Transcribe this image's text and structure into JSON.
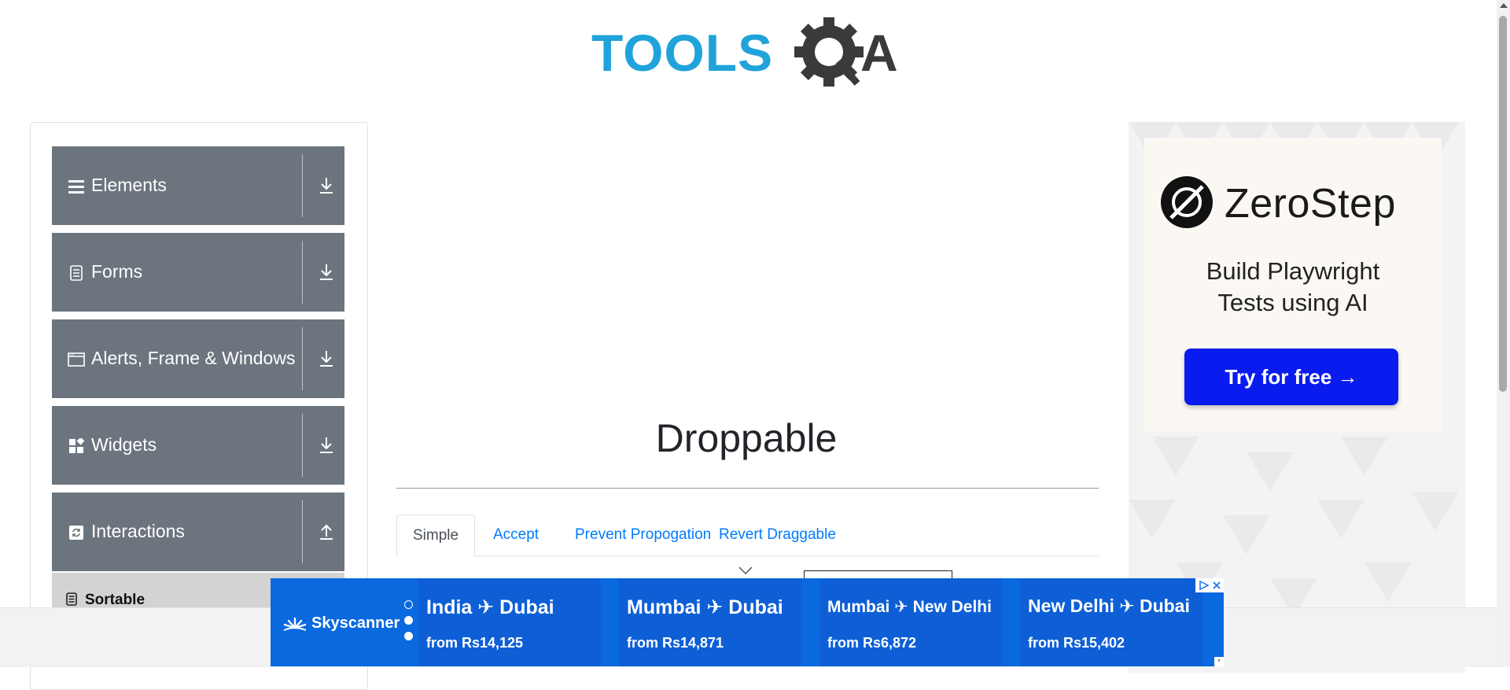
{
  "header": {
    "logo_alt": "TOOLSQA"
  },
  "sidebar": {
    "groups": [
      {
        "label": "Elements",
        "icon": "hamburger-icon",
        "arrow": "download-arrow-icon"
      },
      {
        "label": "Forms",
        "icon": "document-icon",
        "arrow": "download-arrow-icon"
      },
      {
        "label": "Alerts, Frame & Windows",
        "icon": "window-icon",
        "arrow": "download-arrow-icon"
      },
      {
        "label": "Widgets",
        "icon": "widgets-icon",
        "arrow": "download-arrow-icon"
      },
      {
        "label": "Interactions",
        "icon": "interactions-icon",
        "arrow": "upload-arrow-icon"
      }
    ],
    "subitems": [
      {
        "label": "Sortable",
        "icon": "document-icon"
      }
    ]
  },
  "main": {
    "title": "Droppable",
    "tabs": [
      {
        "label": "Simple",
        "active": true
      },
      {
        "label": "Accept",
        "active": false
      },
      {
        "label": "Prevent Propogation",
        "active": false
      },
      {
        "label": "Revert Draggable",
        "active": false
      }
    ]
  },
  "right_ad": {
    "brand": "ZeroStep",
    "tagline_line1": "Build Playwright",
    "tagline_line2": "Tests using AI",
    "cta": "Try for free →",
    "cta_color": "#0a1bf0"
  },
  "bottom_ad": {
    "brand": "Skyscanner",
    "deals": [
      {
        "route": "India ✈ Dubai",
        "price": "from Rs14,125"
      },
      {
        "route": "Mumbai ✈ Dubai",
        "price": "from Rs14,871"
      },
      {
        "route": "Mumbai ✈ New Delhi",
        "price": "from Rs6,872"
      },
      {
        "route": "New Delhi ✈ Dubai",
        "price": "from Rs15,402"
      }
    ],
    "background_color": "#0b69e0"
  },
  "colors": {
    "brand_blue": "#1fa3da",
    "sidebar_gray": "#6c757d",
    "link_blue": "#007bff"
  }
}
